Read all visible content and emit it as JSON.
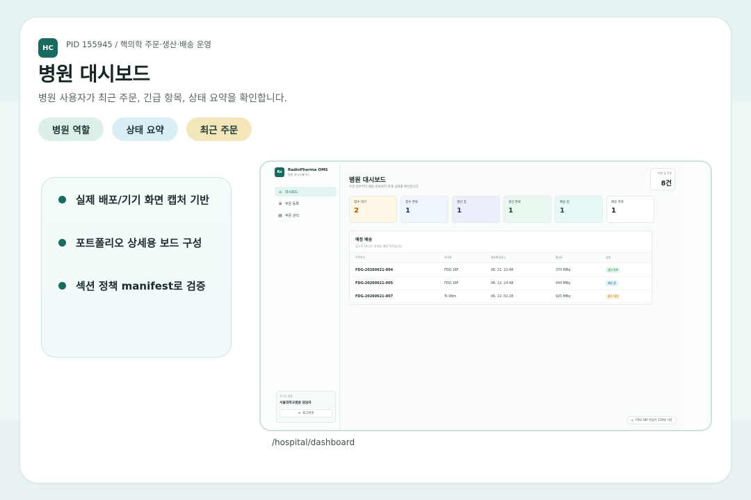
{
  "header": {
    "logo_text": "HC",
    "breadcrumb": "PID 155945 / 핵의학 주문·생산·배송 운영",
    "title": "병원 대시보드",
    "subtitle": "병원 사용자가 최근 주문, 긴급 항목, 상태 요약을 확인합니다."
  },
  "chips": [
    "병원 역할",
    "상태 요약",
    "최근 주문"
  ],
  "features": [
    "실제 배포/기기 화면 캡처 기반",
    "포트폴리오 상세용 보드 구성",
    "섹션 정책 manifest로 검증"
  ],
  "route": "/hospital/dashboard",
  "app": {
    "brand_mark": "Rx",
    "brand_name": "RadioPharma OMS",
    "brand_sub": "병원 워크스페이스",
    "nav": [
      {
        "label": "대시보드",
        "icon": "⌂"
      },
      {
        "label": "주문 등록",
        "icon": "⊕"
      },
      {
        "label": "주문 관리",
        "icon": "▤"
      }
    ],
    "user_label": "로그인 계정",
    "user_name": "서울대학교병원 담당자",
    "logout": "로그아웃",
    "logout_icon": "⇥",
    "title": "병원 대시보드",
    "subtitle": "주문 접수부터 배송 완료까지 현재 상태를 확인합니다.",
    "today_label": "이번 달 주문",
    "today_value": "8건",
    "stats": [
      {
        "label": "접수 대기",
        "value": "2",
        "bg": "#fff8e6",
        "color": "#b55a00"
      },
      {
        "label": "접수 완료",
        "value": "1",
        "bg": "#eef5fd",
        "color": "#1c3a5a"
      },
      {
        "label": "생산 중",
        "value": "1",
        "bg": "#eceefb",
        "color": "#2a2f6a"
      },
      {
        "label": "생산 완료",
        "value": "1",
        "bg": "#ebf8f0",
        "color": "#1a4a30"
      },
      {
        "label": "배송 중",
        "value": "1",
        "bg": "#e8f8f8",
        "color": "#1a4a4a"
      },
      {
        "label": "배송 완료",
        "value": "1",
        "bg": "#ffffff",
        "color": "#152525"
      }
    ],
    "panel_title": "예정 배송",
    "panel_sub": "앞으로 24시간 내 배송 예정 주문입니다.",
    "columns": [
      "주문번호",
      "의약품",
      "배송희망일시",
      "활성도",
      "상태"
    ],
    "rows": [
      {
        "id": "FDG-20260621-004",
        "drug": "FDG 18F",
        "time": "06. 21. 22:48",
        "activity": "370 MBq",
        "status": "생산 완료",
        "status_bg": "#e3f6ea",
        "status_color": "#1f7a45"
      },
      {
        "id": "FDG-20260621-005",
        "drug": "FDG 18F",
        "time": "06. 22. 24:48",
        "activity": "444 MBq",
        "status": "배송 중",
        "status_bg": "#e0f4f6",
        "status_color": "#1a6a7a"
      },
      {
        "id": "FDG-20260621-007",
        "drug": "Tc-99m",
        "time": "06. 22. 02:28",
        "activity": "925 MBq",
        "status": "접수 대기",
        "status_bg": "#fdf1dc",
        "status_color": "#a05a00"
      }
    ],
    "footer_note": "FDG 18F 반감기 110분 기준",
    "footer_icon": "◷"
  }
}
